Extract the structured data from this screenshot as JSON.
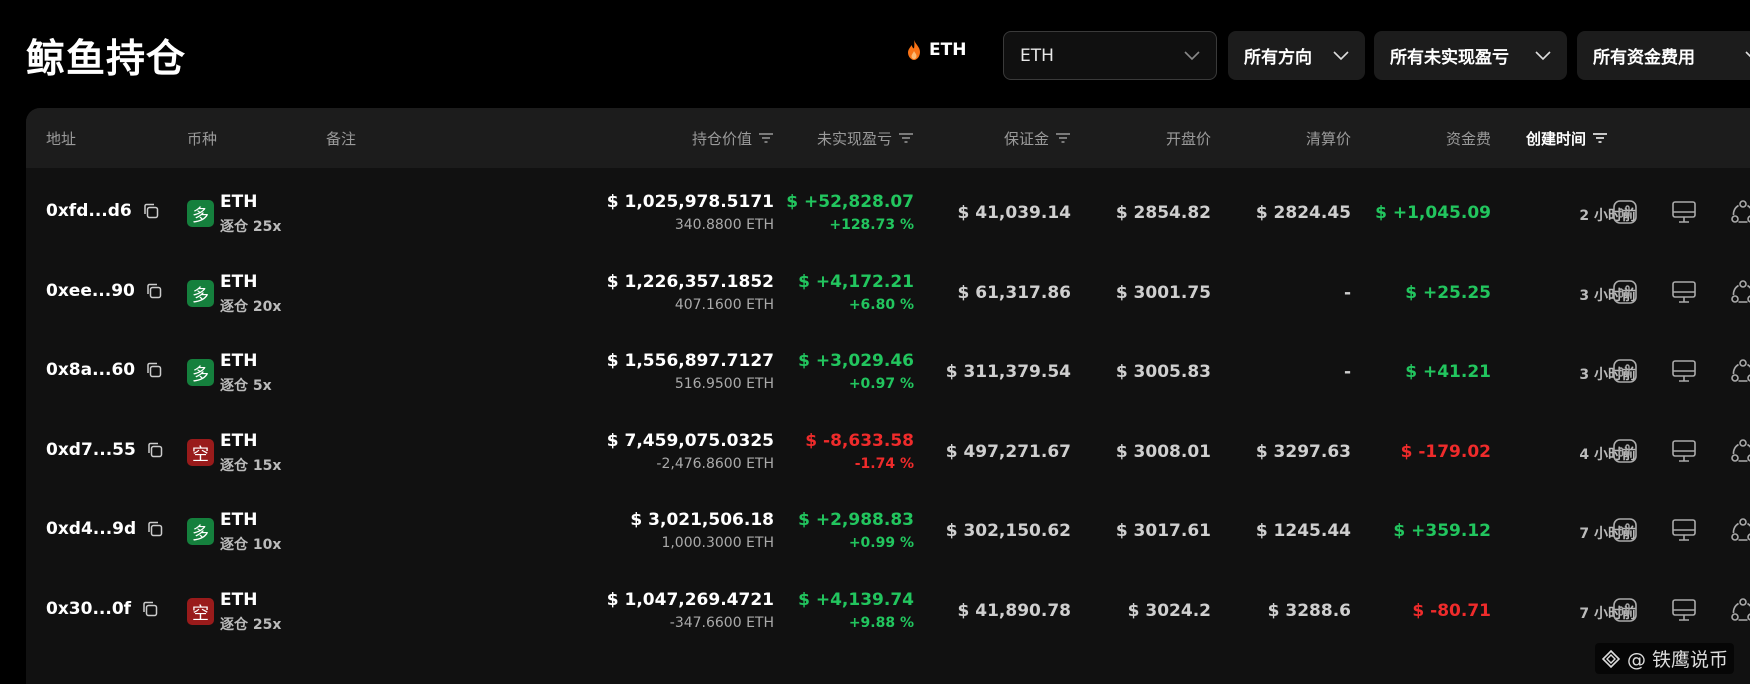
{
  "page": {
    "title": "鲸鱼持仓"
  },
  "filters": {
    "coin_tag": "ETH",
    "coin_select": "ETH",
    "direction": "所有方向",
    "unrealized_pnl": "所有未实现盈亏",
    "funding_fee": "所有资金费用"
  },
  "table": {
    "headers": {
      "address": "地址",
      "coin": "币种",
      "note": "备注",
      "position_value": "持仓价值",
      "unrealized_pnl": "未实现盈亏",
      "margin": "保证金",
      "open_price": "开盘价",
      "liq_price": "清算价",
      "funding_fee": "资金费",
      "created_time": "创建时间"
    },
    "rows": [
      {
        "address": "0xfd...d6",
        "side": "多",
        "side_type": "long",
        "symbol": "ETH",
        "leverage": "逐仓 25x",
        "value": "$ 1,025,978.5171",
        "size": "340.8800 ETH",
        "pnl": "$ +52,828.07",
        "pnl_pct": "+128.73 %",
        "pnl_sign": "pos",
        "margin": "$ 41,039.14",
        "open": "$ 2854.82",
        "liq": "$ 2824.45",
        "fee": "$ +1,045.09",
        "fee_sign": "pos",
        "time": "2 小时前"
      },
      {
        "address": "0xee...90",
        "side": "多",
        "side_type": "long",
        "symbol": "ETH",
        "leverage": "逐仓 20x",
        "value": "$ 1,226,357.1852",
        "size": "407.1600 ETH",
        "pnl": "$ +4,172.21",
        "pnl_pct": "+6.80 %",
        "pnl_sign": "pos",
        "margin": "$ 61,317.86",
        "open": "$ 3001.75",
        "liq": "-",
        "fee": "$ +25.25",
        "fee_sign": "pos",
        "time": "3 小时前"
      },
      {
        "address": "0x8a...60",
        "side": "多",
        "side_type": "long",
        "symbol": "ETH",
        "leverage": "逐仓 5x",
        "value": "$ 1,556,897.7127",
        "size": "516.9500 ETH",
        "pnl": "$ +3,029.46",
        "pnl_pct": "+0.97 %",
        "pnl_sign": "pos",
        "margin": "$ 311,379.54",
        "open": "$ 3005.83",
        "liq": "-",
        "fee": "$ +41.21",
        "fee_sign": "pos",
        "time": "3 小时前"
      },
      {
        "address": "0xd7...55",
        "side": "空",
        "side_type": "short",
        "symbol": "ETH",
        "leverage": "逐仓 15x",
        "value": "$ 7,459,075.0325",
        "size": "-2,476.8600 ETH",
        "pnl": "$ -8,633.58",
        "pnl_pct": "-1.74 %",
        "pnl_sign": "neg",
        "margin": "$ 497,271.67",
        "open": "$ 3008.01",
        "liq": "$ 3297.63",
        "fee": "$ -179.02",
        "fee_sign": "neg",
        "time": "4 小时前"
      },
      {
        "address": "0xd4...9d",
        "side": "多",
        "side_type": "long",
        "symbol": "ETH",
        "leverage": "逐仓 10x",
        "value": "$ 3,021,506.18",
        "size": "1,000.3000 ETH",
        "pnl": "$ +2,988.83",
        "pnl_pct": "+0.99 %",
        "pnl_sign": "pos",
        "margin": "$ 302,150.62",
        "open": "$ 3017.61",
        "liq": "$ 1245.44",
        "fee": "$ +359.12",
        "fee_sign": "pos",
        "time": "7 小时前"
      },
      {
        "address": "0x30...0f",
        "side": "空",
        "side_type": "short",
        "symbol": "ETH",
        "leverage": "逐仓 25x",
        "value": "$ 1,047,269.4721",
        "size": "-347.6600 ETH",
        "pnl": "$ +4,139.74",
        "pnl_pct": "+9.88 %",
        "pnl_sign": "pos",
        "margin": "$ 41,890.78",
        "open": "$ 3024.2",
        "liq": "$ 3288.6",
        "fee": "$ -80.71",
        "fee_sign": "neg",
        "time": "7 小时前"
      }
    ]
  },
  "watermark": {
    "text": "@ 铁鹰说币"
  }
}
